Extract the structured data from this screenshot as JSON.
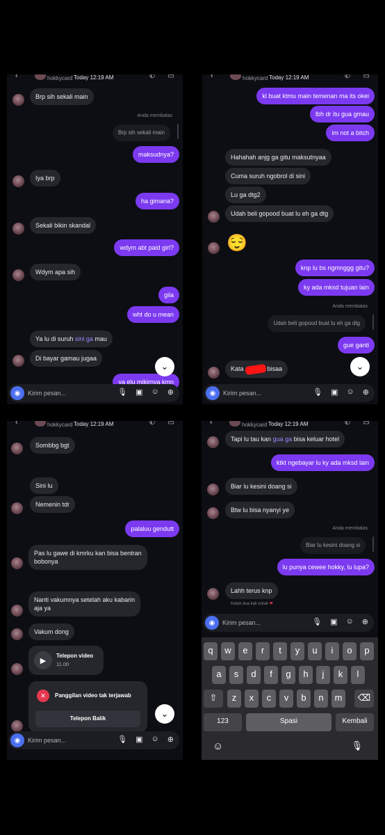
{
  "header": {
    "name": "hokkycard",
    "time": "Today 12:19 AM"
  },
  "composer": {
    "placeholder": "Kirim pesan..."
  },
  "labels": {
    "replied": "Anda membalas"
  },
  "p1": {
    "m1": "Brp sih sekali main",
    "r1": "Brp sih sekali main",
    "m2": "maksudnya?",
    "m3": "Iya brp",
    "m4": "ha gimana?",
    "m5": "Sekali bikin skandal",
    "m6": "wdym abt paid girl?",
    "m7": "Wdym apa sih",
    "m8": "gila",
    "m9": "wht do u mean",
    "m10a": "Ya lu di suruh ",
    "m10b": "sini ga",
    "m10c": " mau",
    "m11": "Di bayar gamau jugaa",
    "m12": "ya elu mikirnya kmn"
  },
  "p2": {
    "m1": "kl buat ktmu main temenan ma its okei",
    "m2": "lbh dr itu gua gmau",
    "m3": "im not a bitch",
    "m4": "Hahahah anjg ga gitu maksutnyaa",
    "m5": "Cuma suruh ngobrol di sini",
    "m6": "Lu ga dtg2",
    "m7": "Udah beli gopood buat lu eh ga dtg",
    "emoji": "😌",
    "m8": "knp lu bs ngmnggg gitu?",
    "m9": "ky ada mksd tujuan lain",
    "r1": "Udah beli gopood buat lu eh ga dtg",
    "m10": "gue ganti",
    "m11a": "Kata",
    "m11b": "bisaa"
  },
  "p3": {
    "m1": "Sombbg bgt",
    "m2": "Sini lu",
    "m3": "Nemenin tdr",
    "m4": "palaluu gendutt",
    "m5a": "Pas lu gawe di kmrku kan bisa bentran",
    "m5b": "bobonya",
    "m6a": "Nanti vakumnya setelah aku kabarin",
    "m6b": "aja ya",
    "m7": "Vakum dong",
    "call_title": "Telepon video",
    "call_time": "11.00",
    "missed": "Panggilan video tak terjawab",
    "callback": "Telepon Balik"
  },
  "p4": {
    "m1a": "Tapi lu tau kan ",
    "m1b": "gua ga",
    "m1c": " bisa keluar hotel",
    "m2": "ktkt ngebayar lu ky ada mksd lain",
    "m3": "Biar lu kesini doang si",
    "m4": "Btw lu bisa nyanyi ye",
    "r1": "Biar lu kesini doang si",
    "m5": "lu punya cewee hokky, lu lupa?",
    "m6": "Lahh terus knp",
    "hint": "Ketuk dua kali untuk"
  },
  "keyboard": {
    "row1": [
      "q",
      "w",
      "e",
      "r",
      "t",
      "y",
      "u",
      "i",
      "o",
      "p"
    ],
    "row2": [
      "a",
      "s",
      "d",
      "f",
      "g",
      "h",
      "j",
      "k",
      "l"
    ],
    "row3": [
      "z",
      "x",
      "c",
      "v",
      "b",
      "n",
      "m"
    ],
    "num": "123",
    "space": "Spasi",
    "ret": "Kembali"
  }
}
